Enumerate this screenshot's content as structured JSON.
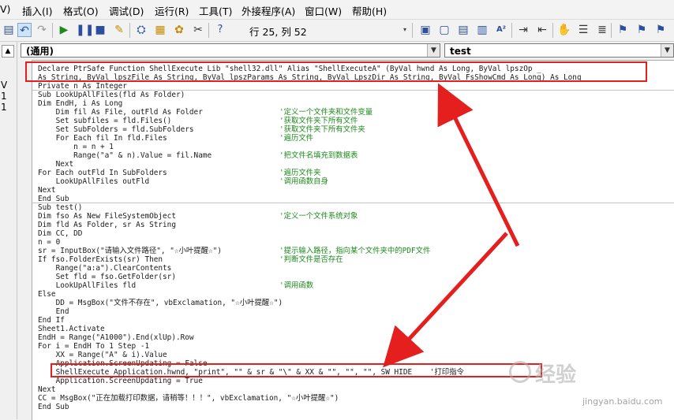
{
  "menubar": {
    "items": [
      "V)",
      "插入(I)",
      "格式(O)",
      "调试(D)",
      "运行(R)",
      "工具(T)",
      "外接程序(A)",
      "窗口(W)",
      "帮助(H)"
    ]
  },
  "toolbar": {
    "icons": [
      "undo-icon",
      "redo-icon",
      "run-icon",
      "pause-icon",
      "stop-icon",
      "design-mode-icon",
      "project-explorer-icon",
      "properties-icon",
      "object-browser-icon",
      "toolbox-icon",
      "help-icon",
      "list-properties-icon",
      "list-constants-icon",
      "quick-info-icon",
      "parameter-info-icon",
      "complete-word-icon",
      "indent-icon",
      "outdent-icon",
      "toggle-breakpoint-icon",
      "comment-block-icon",
      "uncomment-block-icon",
      "toggle-bookmark-icon",
      "next-bookmark-icon",
      "prev-bookmark-icon"
    ],
    "cursor_position": "行 25, 列 52"
  },
  "left_strip": {
    "chars": [
      "V",
      "1",
      "1"
    ]
  },
  "object_combo": {
    "value": "(通用)"
  },
  "proc_combo": {
    "value": "test"
  },
  "code_lines": [
    {
      "code": "Declare PtrSafe Function ShellExecute Lib \"shell32.dll\" Alias \"ShellExecuteA\" (ByVal hwnd As Long, ByVal lpszOp _",
      "comment": ""
    },
    {
      "code": "As String, ByVal lpszFile As String, ByVal lpszParams As String, ByVal LpszDir As String, ByVal FsShowCmd As Long) As Long",
      "comment": ""
    },
    {
      "code": "Private n As Integer",
      "comment": ""
    },
    {
      "code": "Sub LookUpAllFiles(fld As Folder)",
      "comment": ""
    },
    {
      "code": "Dim EndH, i As Long",
      "comment": ""
    },
    {
      "code": "    Dim fil As File, outFld As Folder",
      "comment": "'定义一个文件夹和文件变量"
    },
    {
      "code": "    Set subfiles = fld.Files()",
      "comment": "'获取文件夹下所有文件"
    },
    {
      "code": "    Set SubFolders = fld.SubFolders",
      "comment": "'获取文件夹下所有文件夹"
    },
    {
      "code": "    For Each fil In fld.Files",
      "comment": "'遍历文件"
    },
    {
      "code": "        n = n + 1",
      "comment": ""
    },
    {
      "code": "        Range(\"a\" & n).Value = fil.Name",
      "comment": "'把文件名填充到数据表"
    },
    {
      "code": "    Next",
      "comment": ""
    },
    {
      "code": "For Each outFld In SubFolders",
      "comment": "'遍历文件夹"
    },
    {
      "code": "    LookUpAllFiles outFld",
      "comment": "'调用函数自身"
    },
    {
      "code": "Next",
      "comment": ""
    },
    {
      "code": "End Sub",
      "comment": ""
    },
    {
      "code": "Sub test()",
      "comment": ""
    },
    {
      "code": "Dim fso As New FileSystemObject",
      "comment": "'定义一个文件系统对象"
    },
    {
      "code": "Dim fld As Folder, sr As String",
      "comment": ""
    },
    {
      "code": "Dim CC, DD",
      "comment": ""
    },
    {
      "code": "n = 0",
      "comment": ""
    },
    {
      "code": "sr = InputBox(\"请输入文件路径\", \"☆小叶提醒☆\")",
      "comment": "'提示输入路径，指向某个文件夹中的PDF文件"
    },
    {
      "code": "If fso.FolderExists(sr) Then",
      "comment": "'判断文件是否存在"
    },
    {
      "code": "    Range(\"a:a\").ClearContents",
      "comment": ""
    },
    {
      "code": "    Set fld = fso.GetFolder(sr)",
      "comment": ""
    },
    {
      "code": "    LookUpAllFiles fld",
      "comment": "'调用函数"
    },
    {
      "code": "Else",
      "comment": ""
    },
    {
      "code": "    DD = MsgBox(\"文件不存在\", vbExclamation, \"☆小叶提醒☆\")",
      "comment": ""
    },
    {
      "code": "    End",
      "comment": ""
    },
    {
      "code": "End If",
      "comment": ""
    },
    {
      "code": "Sheet1.Activate",
      "comment": ""
    },
    {
      "code": "EndH = Range(\"A1000\").End(xlUp).Row",
      "comment": ""
    },
    {
      "code": "For i = EndH To 1 Step -1",
      "comment": ""
    },
    {
      "code": "    XX = Range(\"A\" & i).Value",
      "comment": ""
    },
    {
      "code": "    Application.ScreenUpdating = False",
      "comment": ""
    },
    {
      "code": "    ShellExecute Application.hwnd, \"print\", \"\" & sr & \"\\\" & XX & \"\", \"\", \"\", SW_HIDE    '打印指令",
      "comment": ""
    },
    {
      "code": "    Application.ScreenUpdating = True",
      "comment": ""
    },
    {
      "code": "Next",
      "comment": ""
    },
    {
      "code": "CC = MsgBox(\"正在加载打印数据，请稍等！！！\", vbExclamation, \"☆小叶提醒☆\")",
      "comment": ""
    },
    {
      "code": "End Sub",
      "comment": ""
    }
  ],
  "watermark": {
    "text": "经验",
    "url": "jingyan.baidu.com"
  },
  "colors": {
    "annotation_red": "#e51e1e",
    "comment_green": "#1a8a1a"
  }
}
